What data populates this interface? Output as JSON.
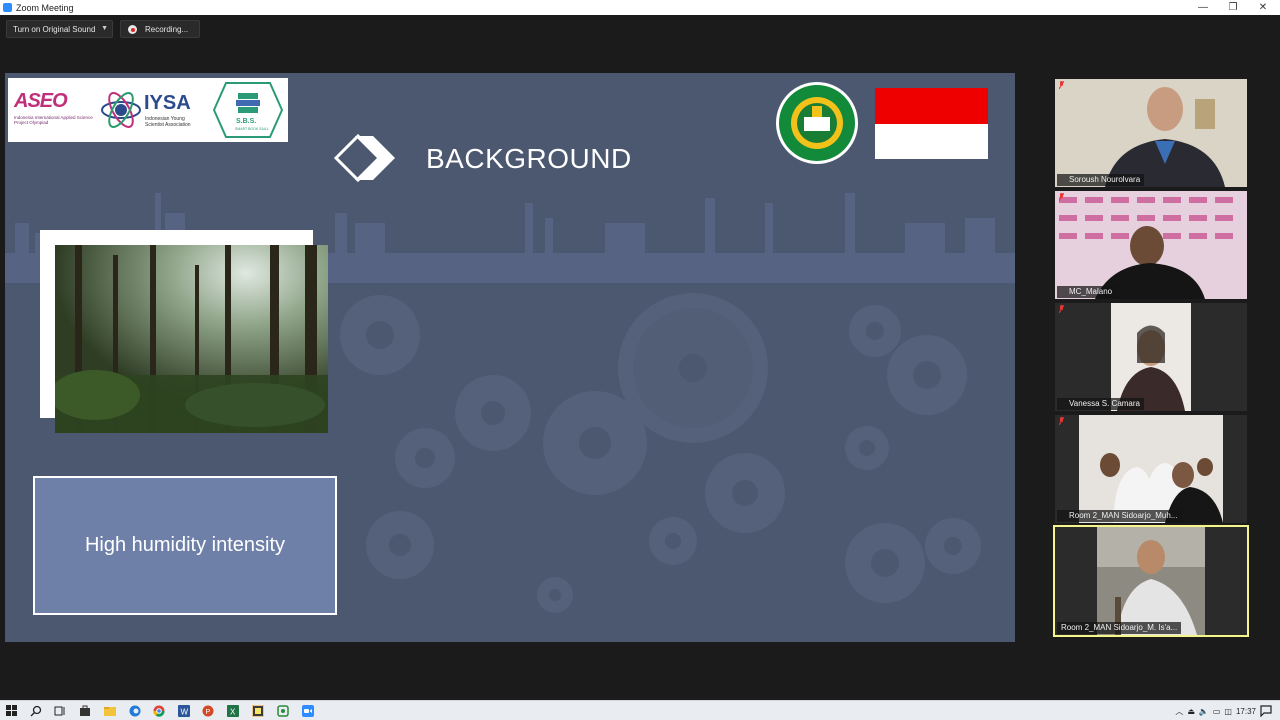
{
  "window": {
    "title": "Zoom Meeting",
    "controls": {
      "minimize": "—",
      "restore": "❐",
      "close": "✕"
    }
  },
  "toolbar": {
    "original_sound_label": "Turn on Original Sound",
    "recording_label": "Recording..."
  },
  "slide": {
    "logos": {
      "aseo_text": "ASEO",
      "aseo_subtitle": "Indonesia International Applied Science Project Olympiad",
      "iysa_text": "IYSA",
      "iysa_subtitle": "Indonesian Young Scientist Association",
      "sbs_text": "S.B.S.",
      "sbs_subtitle": "SMART BOOK SAILL",
      "madrasah_top": "MADRASAH ALIYAH NEGERI",
      "madrasah_bottom": "SIDOARJO"
    },
    "title": "BACKGROUND",
    "text_box": "High humidity intensity",
    "colors": {
      "background": "#4c5870",
      "text_box": "#6f80a8",
      "flag_red": "#ee0000"
    }
  },
  "participants": [
    {
      "name": "Soroush Nourolvara",
      "muted": true,
      "active": false
    },
    {
      "name": "MC_Malano",
      "muted": true,
      "active": false
    },
    {
      "name": "Vanessa  S. Camara",
      "muted": true,
      "active": false
    },
    {
      "name": "Room 2_MAN Sidoarjo_Muh...",
      "muted": true,
      "active": false
    },
    {
      "name": "Room 2_MAN Sidoarjo_M. Is'a...",
      "muted": false,
      "active": true
    }
  ],
  "participants_active_color": "#f6f58a",
  "taskbar": {
    "apps": [
      "start-icon",
      "search-icon",
      "task-view-icon",
      "store-icon",
      "file-explorer-icon",
      "edge-icon",
      "chrome-icon",
      "word-icon",
      "powerpoint-icon",
      "excel-icon",
      "sticky-notes-icon",
      "photos-icon",
      "zoom-icon"
    ],
    "clock": "17:37"
  }
}
